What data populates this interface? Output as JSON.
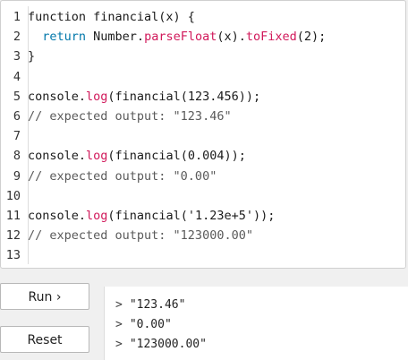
{
  "editor": {
    "lines": [
      {
        "num": "1",
        "parts": [
          {
            "t": "function financial(x) {",
            "c": ""
          }
        ]
      },
      {
        "num": "2",
        "parts": [
          {
            "t": "  return ",
            "c": "kw"
          },
          {
            "t": "Number.",
            "c": ""
          },
          {
            "t": "parseFloat",
            "c": "fn"
          },
          {
            "t": "(x).",
            "c": ""
          },
          {
            "t": "toFixed",
            "c": "fn"
          },
          {
            "t": "(2);",
            "c": ""
          }
        ]
      },
      {
        "num": "3",
        "parts": [
          {
            "t": "}",
            "c": ""
          }
        ]
      },
      {
        "num": "4",
        "parts": []
      },
      {
        "num": "5",
        "parts": [
          {
            "t": "console.",
            "c": ""
          },
          {
            "t": "log",
            "c": "fn"
          },
          {
            "t": "(financial(123.456));",
            "c": ""
          }
        ]
      },
      {
        "num": "6",
        "parts": [
          {
            "t": "// expected output: \"123.46\"",
            "c": "cmt"
          }
        ]
      },
      {
        "num": "7",
        "parts": []
      },
      {
        "num": "8",
        "parts": [
          {
            "t": "console.",
            "c": ""
          },
          {
            "t": "log",
            "c": "fn"
          },
          {
            "t": "(financial(0.004));",
            "c": ""
          }
        ]
      },
      {
        "num": "9",
        "parts": [
          {
            "t": "// expected output: \"0.00\"",
            "c": "cmt"
          }
        ]
      },
      {
        "num": "10",
        "parts": []
      },
      {
        "num": "11",
        "parts": [
          {
            "t": "console.",
            "c": ""
          },
          {
            "t": "log",
            "c": "fn"
          },
          {
            "t": "(financial('1.23e+5'));",
            "c": ""
          }
        ]
      },
      {
        "num": "12",
        "parts": [
          {
            "t": "// expected output: \"123000.00\"",
            "c": "cmt"
          }
        ]
      },
      {
        "num": "13",
        "parts": []
      }
    ]
  },
  "buttons": {
    "run_label": "Run ›",
    "reset_label": "Reset"
  },
  "console": {
    "prompt": ">",
    "outputs": [
      "\"123.46\"",
      "\"0.00\"",
      "\"123000.00\""
    ]
  },
  "colors": {
    "function_accent": "#d1185a",
    "keyword": "#0077aa",
    "comment": "#5a5a5a"
  }
}
